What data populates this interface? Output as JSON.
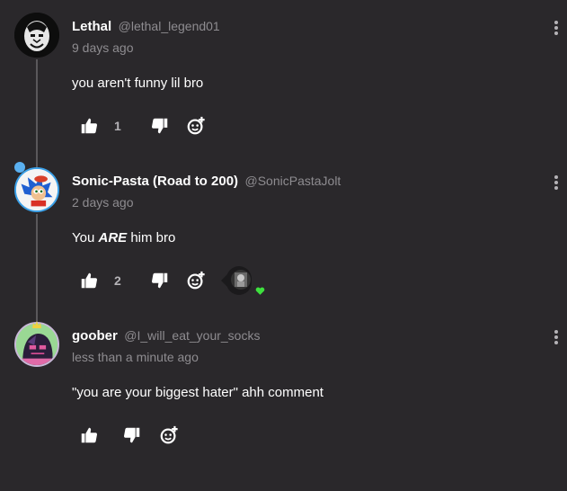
{
  "comments": [
    {
      "name": "Lethal",
      "handle": "@lethal_legend01",
      "time": "9 days ago",
      "body": "you aren't funny lil bro",
      "likes": "1"
    },
    {
      "name": "Sonic-Pasta (Road to 200)",
      "handle": "@SonicPastaJolt",
      "time": "2 days ago",
      "body_pre": "You ",
      "body_em": "ARE",
      "body_post": " him bro",
      "likes": "2"
    },
    {
      "name": "goober",
      "handle": "@I_will_eat_your_socks",
      "time": "less than a minute ago",
      "body": "\"you are your biggest hater\" ahh comment",
      "likes": ""
    }
  ],
  "colors": {
    "background": "#2a282b",
    "muted_text": "#8e8c90",
    "icon": "#ffffff",
    "thread_line": "#5a585b",
    "online_heart": "#3ee03e"
  },
  "icons": [
    "thumbs-up-icon",
    "thumbs-down-icon",
    "add-sticker-icon",
    "more-options-icon"
  ]
}
